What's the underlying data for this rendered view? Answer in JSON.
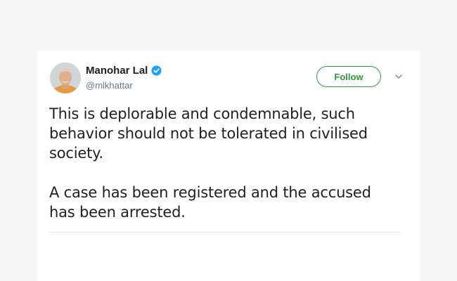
{
  "user": {
    "name": "Manohar Lal",
    "handle": "@mlkhattar",
    "verified": true
  },
  "actions": {
    "follow_label": "Follow"
  },
  "tweet": {
    "paragraph1": "This is deplorable and condemnable, such behavior should not be tolerated in civilised society.",
    "paragraph2": "A case has been registered and the accused has been arrested."
  },
  "colors": {
    "accent": "#2e9a35",
    "verified_badge": "#1da1f2",
    "text": "#1c2022",
    "muted": "#697882",
    "background": "#f7f7f7",
    "card": "#ffffff"
  }
}
